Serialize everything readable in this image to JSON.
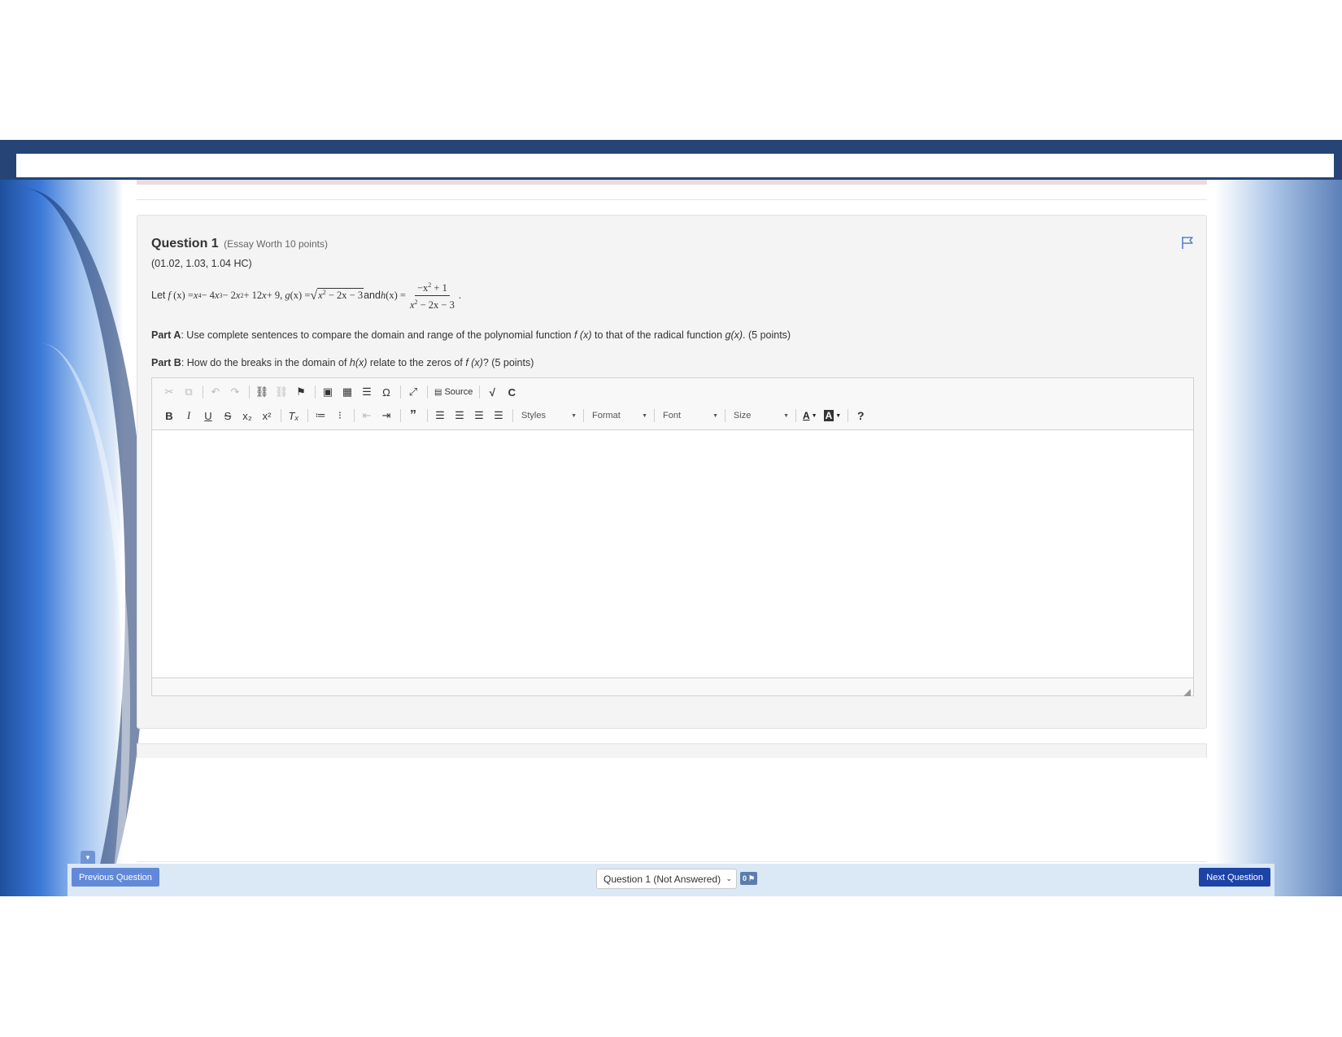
{
  "question": {
    "title": "Question 1",
    "worth": "(Essay Worth 10 points)",
    "codes": "(01.02, 1.03, 1.04 HC)",
    "flag_icon": "flag-outline-icon",
    "math": {
      "let": "Let",
      "f_name": "f",
      "f_arg": "(x) = ",
      "f_expr": {
        "x1": "x",
        "e1": "4",
        "t2": " − 4",
        "x2": "x",
        "e2": "3",
        "t3": " − 2",
        "x3": "x",
        "e3": "2",
        "t4": " + 12",
        "x4": "x",
        "t5": " + 9, "
      },
      "g_name": "g",
      "g_arg": "(x) = ",
      "g_rad_pre": "x",
      "g_rad_exp": "2",
      "g_rad_post": " − 2x − 3",
      "and": " and ",
      "h_name": "h",
      "h_arg": "(x) = ",
      "h_num_pre": "−x",
      "h_num_exp": "2",
      "h_num_post": " + 1",
      "h_den_pre": "x",
      "h_den_exp": "2",
      "h_den_post": " − 2x − 3",
      "end": "."
    },
    "part_a": {
      "label": "Part A",
      "text1": ": Use complete sentences to compare the domain and range of the polynomial function ",
      "fn1": "f (x)",
      "text2": " to that of the radical function ",
      "fn2": "g(x)",
      "text3": ". (5 points)"
    },
    "part_b": {
      "label": "Part B",
      "text1": ": How do the breaks in the domain of ",
      "fn1": "h(x)",
      "text2": " relate to the zeros of ",
      "fn2": "f (x)",
      "text3": "? (5 points)"
    }
  },
  "editor": {
    "source_label": "Source",
    "styles_label": "Styles",
    "format_label": "Format",
    "font_label": "Font",
    "size_label": "Size",
    "help_label": "?",
    "text_color_label": "A",
    "bg_color_label": "A",
    "content": ""
  },
  "nav": {
    "previous_label": "Previous Question",
    "next_label": "Next Question",
    "question_select_value": "Question 1 (Not Answered)",
    "flag_count": "0"
  },
  "colors": {
    "top_bar": "#264576",
    "next_button": "#1d43a7",
    "previous_button": "#6189d8",
    "nav_bar": "#dbe8f6",
    "card_bg": "#f4f4f4"
  }
}
